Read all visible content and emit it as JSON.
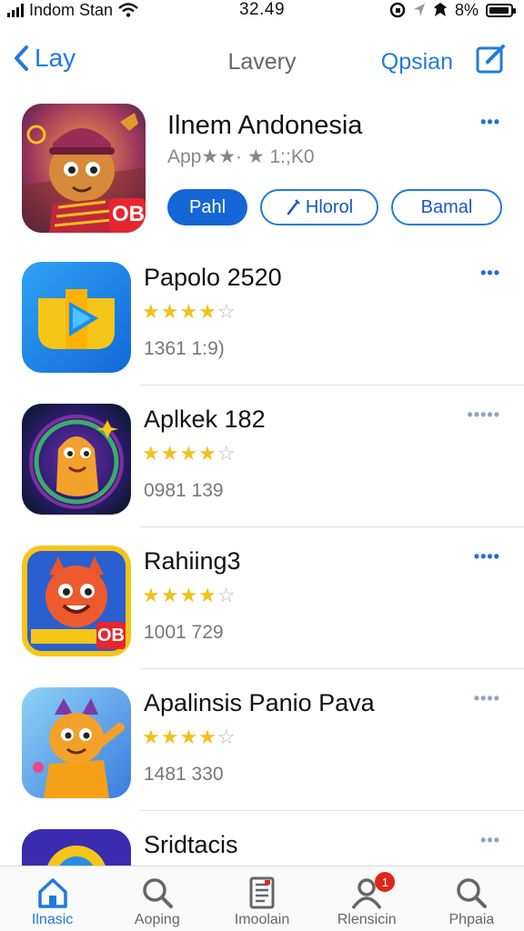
{
  "status_bar": {
    "carrier": "Indom Stan",
    "time": "32.49",
    "battery": "8%"
  },
  "nav": {
    "back_label": "Lay",
    "title": "Lavery",
    "option_label": "Qpsian"
  },
  "featured": {
    "name": "Ilnem Andonesia",
    "subtitle": "App★★· ★ 1:;K0",
    "more": "•••",
    "actions": {
      "primary": "Pahl",
      "secondary": "Hlorol",
      "tertiary": "Bamal"
    },
    "icon_badge": "OB"
  },
  "apps": [
    {
      "name": "Papolo 2520",
      "stars": "★★★★",
      "empty_stars": "☆",
      "count": "1361 1:9)",
      "more": "•••",
      "more_style": "dark"
    },
    {
      "name": "Aplkek 182",
      "stars": "★★★★",
      "empty_stars": "☆",
      "count": "0981 139",
      "more": "•••••",
      "more_style": "light"
    },
    {
      "name": "Rahiing3",
      "stars": "★★★★",
      "empty_stars": "☆",
      "count": "1001 729",
      "more": "••••",
      "more_style": "dark"
    },
    {
      "name": "Apalinsis Panio Pava",
      "stars": "★★★★",
      "empty_stars": "☆",
      "count": "1481 330",
      "more": "••••",
      "more_style": "light"
    }
  ],
  "partial_app": {
    "name": "Sridtacis",
    "more": "•••"
  },
  "tabs": [
    {
      "label": "Ilnasic",
      "icon": "home-icon",
      "active": true
    },
    {
      "label": "Aoping",
      "icon": "search-icon",
      "active": false
    },
    {
      "label": "Imoolain",
      "icon": "document-icon",
      "active": false
    },
    {
      "label": "Rlensicin",
      "icon": "profile-icon",
      "active": false,
      "badge": "1"
    },
    {
      "label": "Phpaia",
      "icon": "search-icon",
      "active": false
    }
  ],
  "colors": {
    "accent": "#1f7be0",
    "star": "#f2c21c",
    "badge": "#e0261b"
  }
}
